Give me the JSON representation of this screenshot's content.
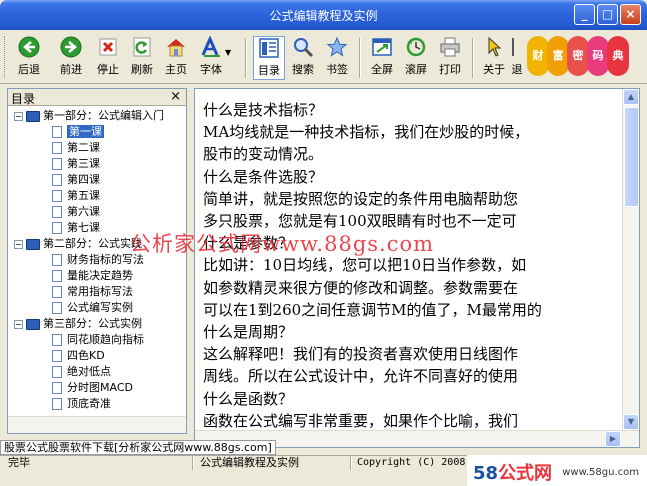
{
  "window": {
    "title": "公式编辑教程及实例"
  },
  "toolbar": {
    "back": "后退",
    "forward": "前进",
    "stop": "停止",
    "refresh": "刷新",
    "home": "主页",
    "font": "字体",
    "toc": "目录",
    "search": "搜索",
    "bookmark": "书签",
    "fullscreen": "全屏",
    "scroll": "滚屏",
    "print": "打印",
    "about": "关于",
    "exit_partial": "退"
  },
  "sidebar": {
    "title": "目录",
    "part1": "第一部分：公式编辑入门",
    "part1_items": [
      "第一课",
      "第二课",
      "第三课",
      "第四课",
      "第五课",
      "第六课",
      "第七课"
    ],
    "part2": "第二部分：公式实践",
    "part2_items": [
      "财务指标的写法",
      "量能决定趋势",
      "常用指标写法",
      "公式编写实例"
    ],
    "part3": "第三部分：公式实例",
    "part3_items": [
      "同花顺趋向指标",
      "四色KD",
      "绝对低点",
      "分时图MACD",
      "顶底奇准"
    ]
  },
  "content": {
    "lines": [
      "什么是技术指标？",
      "MA均线就是一种技术指标，我们在炒股的时候，",
      "股市的变动情况。",
      "什么是条件选股？",
      "简单讲，就是按照您的设定的条件用电脑帮助您",
      "多只股票，您就是有100双眼睛有时也不一定可",
      "什么是参数？",
      "比如讲：10日均线，您可以把10日当作参数，如",
      "如参数精灵来很方便的修改和调整。参数需要在",
      "可以在1到260之间任意调节M的值了，M最常用的",
      "什么是周期？",
      "这么解释吧！我们有的投资者喜欢使用日线图作",
      "周线。所以在公式设计中，允许不同喜好的使用",
      "什么是函数？",
      "函数在公式编写非常重要，如果作个比喻，我们"
    ]
  },
  "watermark": "公析家公式网www.88gs.com",
  "banner": "股票公式股票软件下载[分析家公式网www.88gs.com]",
  "status": {
    "left": "完毕",
    "middle": "公式编辑教程及实例",
    "right": "Copyright (C) 2008 Je"
  },
  "logo": {
    "num": "58",
    "name": "公式网",
    "url": "www.58gu.com"
  },
  "deco_chars": [
    "财",
    "富",
    "密",
    "码",
    "典"
  ]
}
